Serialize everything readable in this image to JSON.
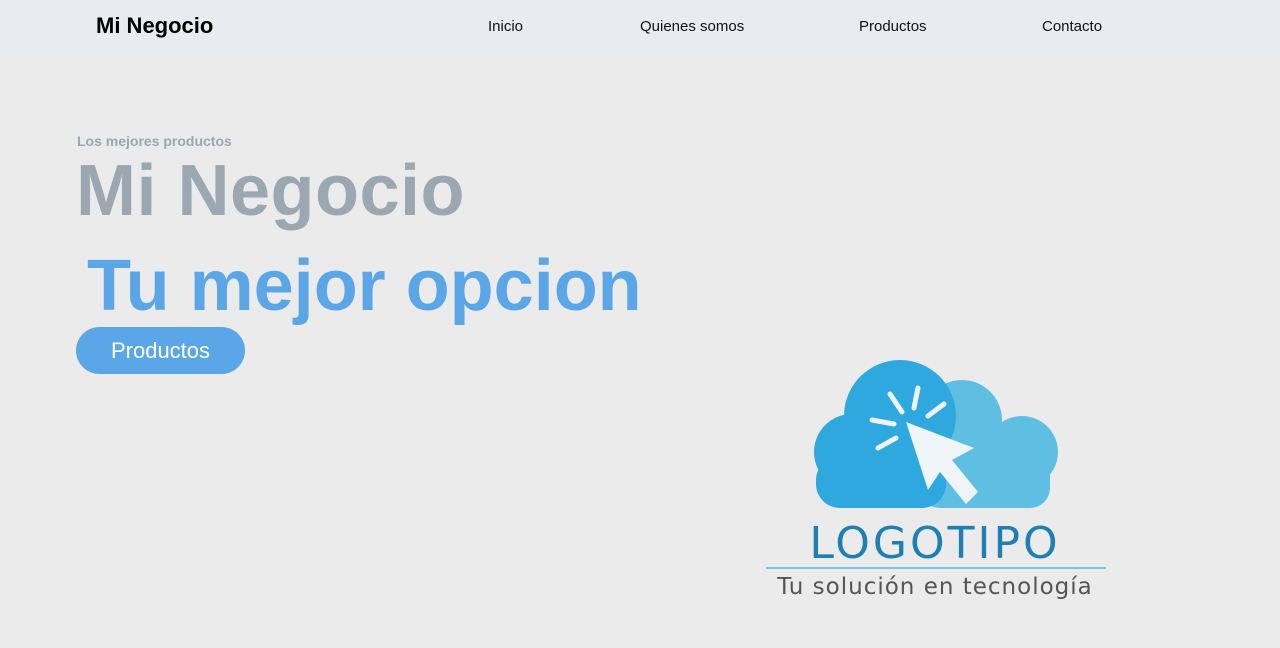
{
  "navbar": {
    "brand": "Mi Negocio",
    "links": [
      "Inicio",
      "Quienes somos",
      "Productos",
      "Contacto"
    ]
  },
  "hero": {
    "kicker": "Los mejores productos",
    "title": "Mi Negocio",
    "subtitle": "Tu mejor opcion",
    "cta_label": "Productos"
  },
  "logo": {
    "icon": "cloud-cursor-icon",
    "wordmark": "LOGOTIPO",
    "tagline": "Tu solución en tecnología"
  },
  "colors": {
    "background": "#ebebeb",
    "navbar": "#e8ecf0",
    "accent": "#5ba6e6",
    "muted_title": "#9ba8b2",
    "logo_dark_blue": "#1d7fb2",
    "logo_cloud_light": "#5fbfe2",
    "logo_cloud_dark": "#2ea8de"
  }
}
